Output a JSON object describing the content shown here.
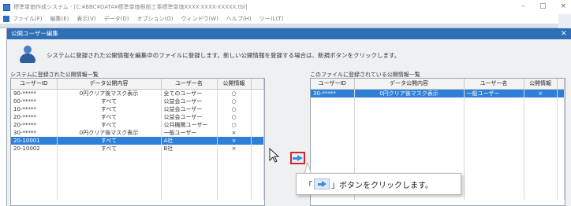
{
  "app": {
    "title": "標準単価作成システム - [C:¥BBC¥DATA¥標準単価根拠工事標準単価XXXX-XXXX-XXXXX.tbl]",
    "window_controls": [
      "–",
      "□",
      "×"
    ],
    "menu": [
      "ファイル(F)",
      "編集(E)",
      "表示(V)",
      "データ(D)",
      "オプション(O)",
      "ウィンドウ(W)",
      "ヘルプ(H)",
      "ツール(T)"
    ]
  },
  "dialog": {
    "title": "公開ユーザー編集",
    "close": "×",
    "info": "システムに登録された公開情報を編集中のファイルに登録します。新しい公開情報を登録する場合は、新規ボタンをクリックします。"
  },
  "left_panel": {
    "label": "システムに登録された公開情報一覧",
    "columns": [
      "ユーザーID",
      "データ公開内容",
      "ユーザー名",
      "公開情報"
    ],
    "rows": [
      [
        "90-*****",
        "0円クリア後マスク表示",
        "全てのユーザー",
        "○"
      ],
      [
        "00-*****",
        "すべて",
        "公益会ユーザー",
        "○"
      ],
      [
        "10-*****",
        "すべて",
        "公益会ユーザー",
        "○"
      ],
      [
        "20-*****",
        "すべて",
        "公益会ユーザー",
        "○"
      ],
      [
        "20-*****",
        "すべて",
        "公共機関ユーザー",
        "○"
      ],
      [
        "30-*****",
        "0円クリア後マスク表示",
        "一般ユーザー",
        "×"
      ],
      [
        "20-10001",
        "すべて",
        "A社",
        "×"
      ],
      [
        "20-10002",
        "すべて",
        "B社",
        "×"
      ]
    ],
    "selected_row": 6
  },
  "right_panel": {
    "label": "このファイルに登録されている公開情報一覧",
    "columns": [
      "ユーザーID",
      "データ公開内容",
      "ユーザー名",
      "公開情報"
    ],
    "rows": [
      [
        "30-*****",
        "0円クリア後マスク表示",
        "一般ユーザー",
        "×"
      ]
    ],
    "selected_row": 0
  },
  "callout": {
    "prefix": "「",
    "suffix": "」ボタンをクリックします。"
  },
  "colors": {
    "accent": "#2e6fb5",
    "selection": "#2e7fd8",
    "highlight_border": "#d8242a"
  }
}
